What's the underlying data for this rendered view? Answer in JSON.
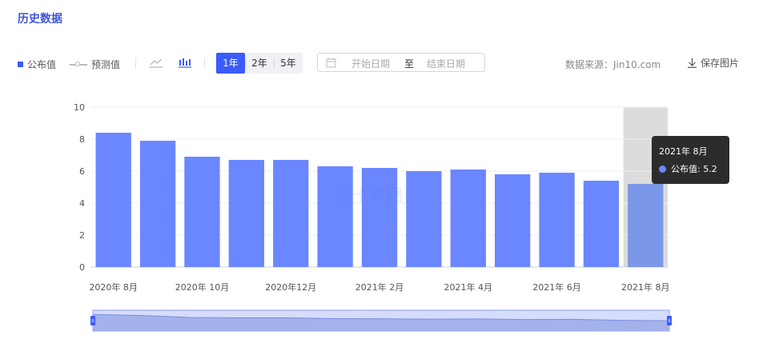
{
  "header": {
    "title": "历史数据"
  },
  "toolbar": {
    "legend_published": "公布值",
    "legend_forecast": "预测值",
    "ranges": [
      "1年",
      "2年",
      "5年"
    ],
    "active_range": "1年",
    "date_start_placeholder": "开始日期",
    "date_to": "至",
    "date_end_placeholder": "结束日期",
    "source": "数据来源：Jin10.com",
    "save": "保存图片"
  },
  "watermark": "金十数据",
  "tooltip": {
    "date": "2021年 8月",
    "label": "公布值: 5.2"
  },
  "colors": {
    "accent": "#3b5bfb",
    "bar": "#6b87ff",
    "bar_highlight": "#7b98e8",
    "tooltip_bg": "#2c2c2c"
  },
  "chart_data": {
    "type": "bar",
    "categories": [
      "2020年 8月",
      "2020年 9月",
      "2020年 10月",
      "2020年 11月",
      "2020年12月",
      "2021年 1月",
      "2021年 2月",
      "2021年 3月",
      "2021年 4月",
      "2021年 5月",
      "2021年 6月",
      "2021年 7月",
      "2021年 8月"
    ],
    "x_tick_labels": [
      "2020年 8月",
      "2020年 10月",
      "2020年12月",
      "2021年 2月",
      "2021年 4月",
      "2021年 6月",
      "2021年 8月"
    ],
    "series": [
      {
        "name": "公布值",
        "values": [
          8.4,
          7.9,
          6.9,
          6.7,
          6.7,
          6.3,
          6.2,
          6.0,
          6.1,
          5.8,
          5.9,
          5.4,
          5.2
        ]
      }
    ],
    "ylim": [
      0,
      10
    ],
    "yticks": [
      0,
      2,
      4,
      6,
      8,
      10
    ],
    "highlighted_index": 12,
    "grid": true,
    "has_zoom_slider": true
  }
}
